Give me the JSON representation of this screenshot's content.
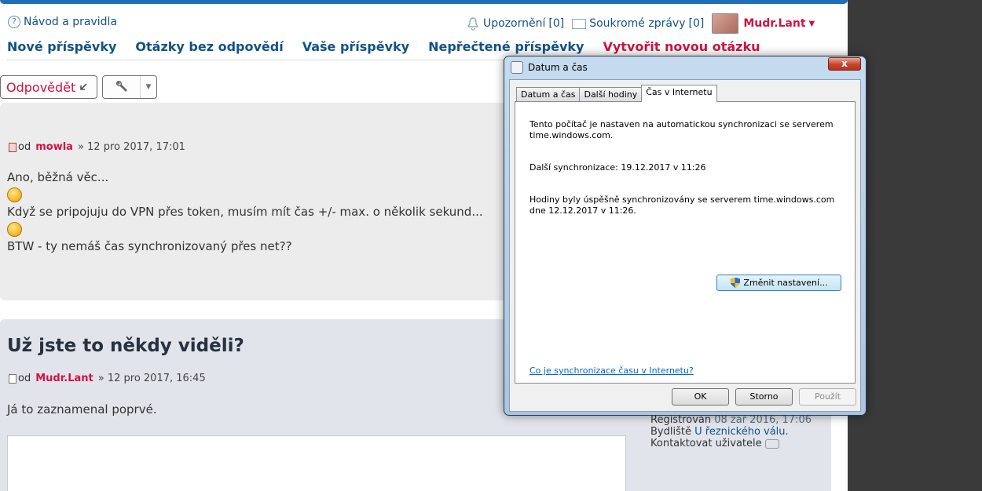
{
  "forum": {
    "help_link": "Návod a pravidla",
    "notifications_label": "Upozornění",
    "notifications_count": "[0]",
    "messages_label": "Soukromé zprávy",
    "messages_count": "[0]",
    "username": "Mudr.Lant",
    "quicklinks": [
      "Nové příspěvky",
      "Otázky bez odpovědí",
      "Vaše příspěvky",
      "Nepřečtené příspěvky",
      "Vytvořit novou otázku"
    ],
    "reply_button": "Odpovědět",
    "post1": {
      "by": "od",
      "author": "mowla",
      "date": "» 12 pro 2017, 17:01",
      "line1": "Ano, běžná věc...",
      "line2": "Když se pripojuju do VPN přes token, musím mít čas +/- max. o několik sekund...",
      "line3": "BTW - ty nemáš čas synchronizovaný přes net??"
    },
    "post2": {
      "title": "Už jste to někdy viděli?",
      "by": "od",
      "author": "Mudr.Lant",
      "date": "» 12 pro 2017, 16:45",
      "text": "Já to zaznamenal poprvé."
    },
    "profile": {
      "registered_label": "Registrován",
      "registered_value": "08 zář 2016, 17:06",
      "residence_label": "Bydliště",
      "residence_value": "U řeznického válu.",
      "contact_label": "Kontaktovat uživatele"
    }
  },
  "dialog": {
    "title": "Datum a čas",
    "close_label": "x",
    "tabs": [
      "Datum a čas",
      "Další hodiny",
      "Čas v Internetu"
    ],
    "line1": "Tento počítač je nastaven na automatickou synchronizaci se serverem time.windows.com.",
    "line2": "Další synchronizace: 19.12.2017 v 11:26",
    "line3": "Hodiny byly úspěšně synchronizovány se serverem time.windows.com dne 12.12.2017 v 11:26.",
    "change_button": "Změnit nastavení...",
    "help_link": "Co je synchronizace času v Internetu?",
    "ok": "OK",
    "cancel": "Storno",
    "apply": "Použít"
  },
  "colors": {
    "link": "#105289",
    "accent_red": "#d31141",
    "topbar": "#1f6fb8"
  },
  "icons": [
    "help-icon",
    "bell-icon",
    "envelope-icon",
    "avatar",
    "reply-arrow-icon",
    "wrench-icon",
    "post-file-icon",
    "laughing-smiley-icon",
    "winking-smiley-icon",
    "speech-bubble-icon",
    "clock-icon",
    "shield-icon"
  ]
}
